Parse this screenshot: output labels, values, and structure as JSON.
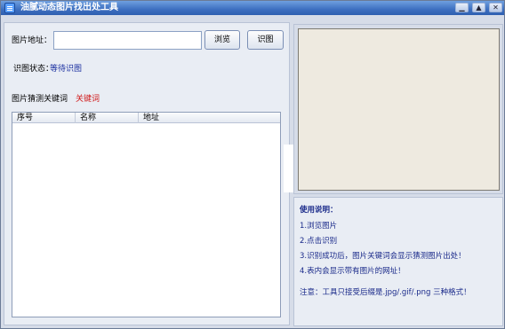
{
  "window": {
    "title": "油腻动态图片找出处工具",
    "controls": {
      "minimize": "▁",
      "maximize": "▲",
      "close": "✕"
    }
  },
  "form": {
    "url_label": "图片地址：",
    "url_value": "",
    "browse_label": "浏览",
    "identify_label": "识图",
    "status_label": "识图状态：",
    "status_value": "等待识图",
    "keywords_label": "图片猜测关键词",
    "keywords_value": "关键词"
  },
  "table": {
    "columns": [
      "序号",
      "名称",
      "地址"
    ],
    "rows": []
  },
  "help": {
    "title": "使用说明：",
    "items": [
      "1.浏览图片",
      "2.点击识别",
      "3.识别成功后，图片关键词会显示猜测图片出处！",
      "4.表内会显示带有图片的网址！"
    ],
    "note": "注意：工具只接受后缀是.jpg/.gif/.png 三种格式！"
  }
}
